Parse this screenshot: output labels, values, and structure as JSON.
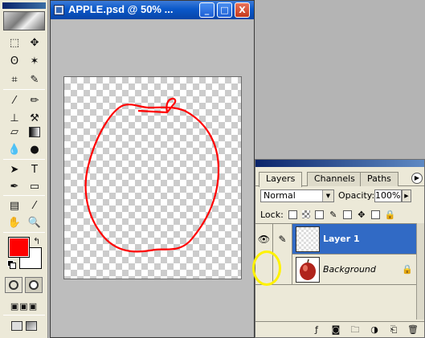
{
  "document": {
    "title": "APPLE.psd @ 50% ...",
    "window_buttons": {
      "minimize": "_",
      "maximize": "□",
      "close": "X"
    }
  },
  "toolbox": {
    "tools": [
      "marquee",
      "move",
      "lasso",
      "magic-wand",
      "crop",
      "slice",
      "healing-brush",
      "brush",
      "clone-stamp",
      "history-brush",
      "eraser",
      "gradient",
      "blur",
      "dodge",
      "path-select",
      "type",
      "pen",
      "rectangle",
      "notes",
      "eyedropper",
      "hand",
      "zoom"
    ],
    "foreground_color": "#ff0000",
    "background_color": "#ffffff"
  },
  "layers_panel": {
    "tabs": [
      "Layers",
      "Channels",
      "Paths"
    ],
    "active_tab": "Layers",
    "blend_mode": "Normal",
    "opacity_label": "Opacity:",
    "opacity_value": "100%",
    "lock_label": "Lock:",
    "layers": [
      {
        "name": "Layer 1",
        "selected": true,
        "visible": true
      },
      {
        "name": "Background",
        "selected": false,
        "visible": false,
        "locked": true
      }
    ]
  }
}
